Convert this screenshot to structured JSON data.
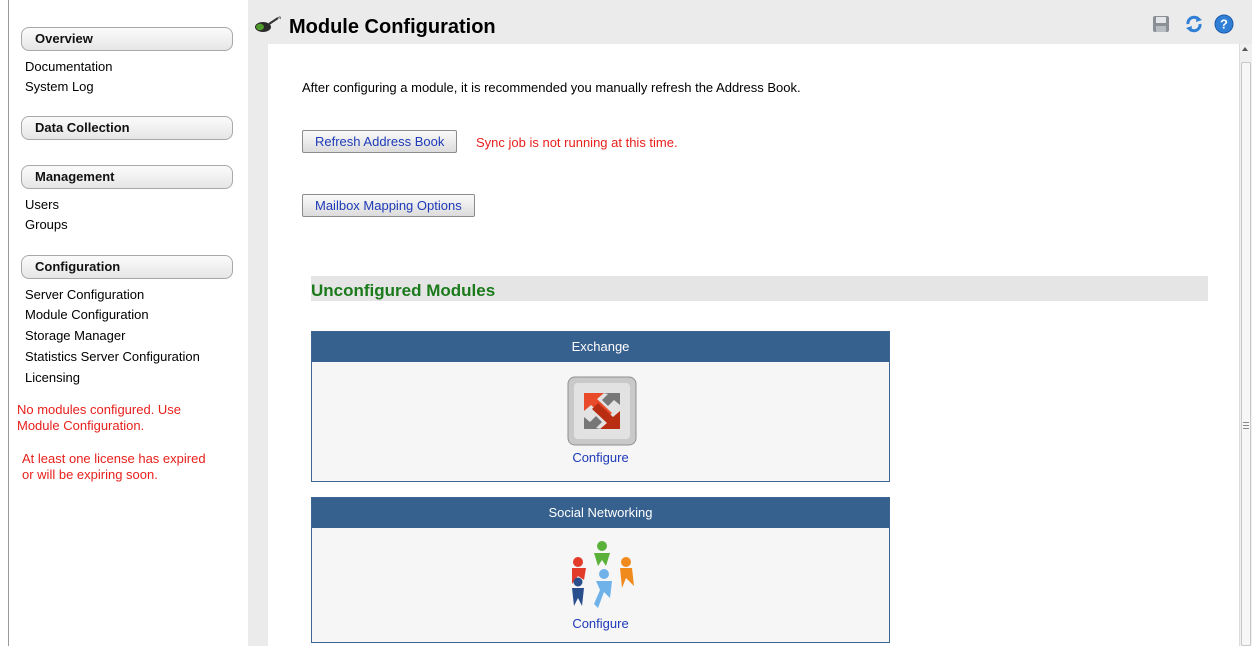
{
  "sidebar": {
    "sections": {
      "overview": "Overview",
      "data_collection": "Data Collection",
      "management": "Management",
      "configuration": "Configuration"
    },
    "links": {
      "documentation": "Documentation",
      "system_log": "System Log",
      "users": "Users",
      "groups": "Groups",
      "server_configuration": "Server Configuration",
      "module_configuration": "Module Configuration",
      "storage_manager": "Storage Manager",
      "statistics_server_configuration": "Statistics Server Configuration",
      "licensing": "Licensing"
    },
    "warnings": {
      "no_modules_line1": "No modules configured. Use",
      "no_modules_line2": "Module Configuration.",
      "license_line1": "At least one license has expired",
      "license_line2": "or will be expiring soon."
    }
  },
  "header": {
    "title": "Module Configuration",
    "icons": [
      "plug-icon",
      "save-icon",
      "refresh-icon",
      "help-icon"
    ]
  },
  "main": {
    "intro": "After configuring a module, it is recommended you manually refresh the Address Book.",
    "refresh_button": "Refresh Address Book",
    "sync_status": "Sync job is not running at this time.",
    "mailbox_button": "Mailbox Mapping Options",
    "unconfigured_title": "Unconfigured Modules",
    "modules": [
      {
        "name": "Exchange",
        "action": "Configure",
        "icon": "exchange-icon"
      },
      {
        "name": "Social Networking",
        "action": "Configure",
        "icon": "social-networking-icon"
      }
    ]
  },
  "colors": {
    "header_blue": "#36608e",
    "warning_red": "#e8201c",
    "link_blue": "#1e3ab8",
    "section_green": "#1b7a1b"
  }
}
